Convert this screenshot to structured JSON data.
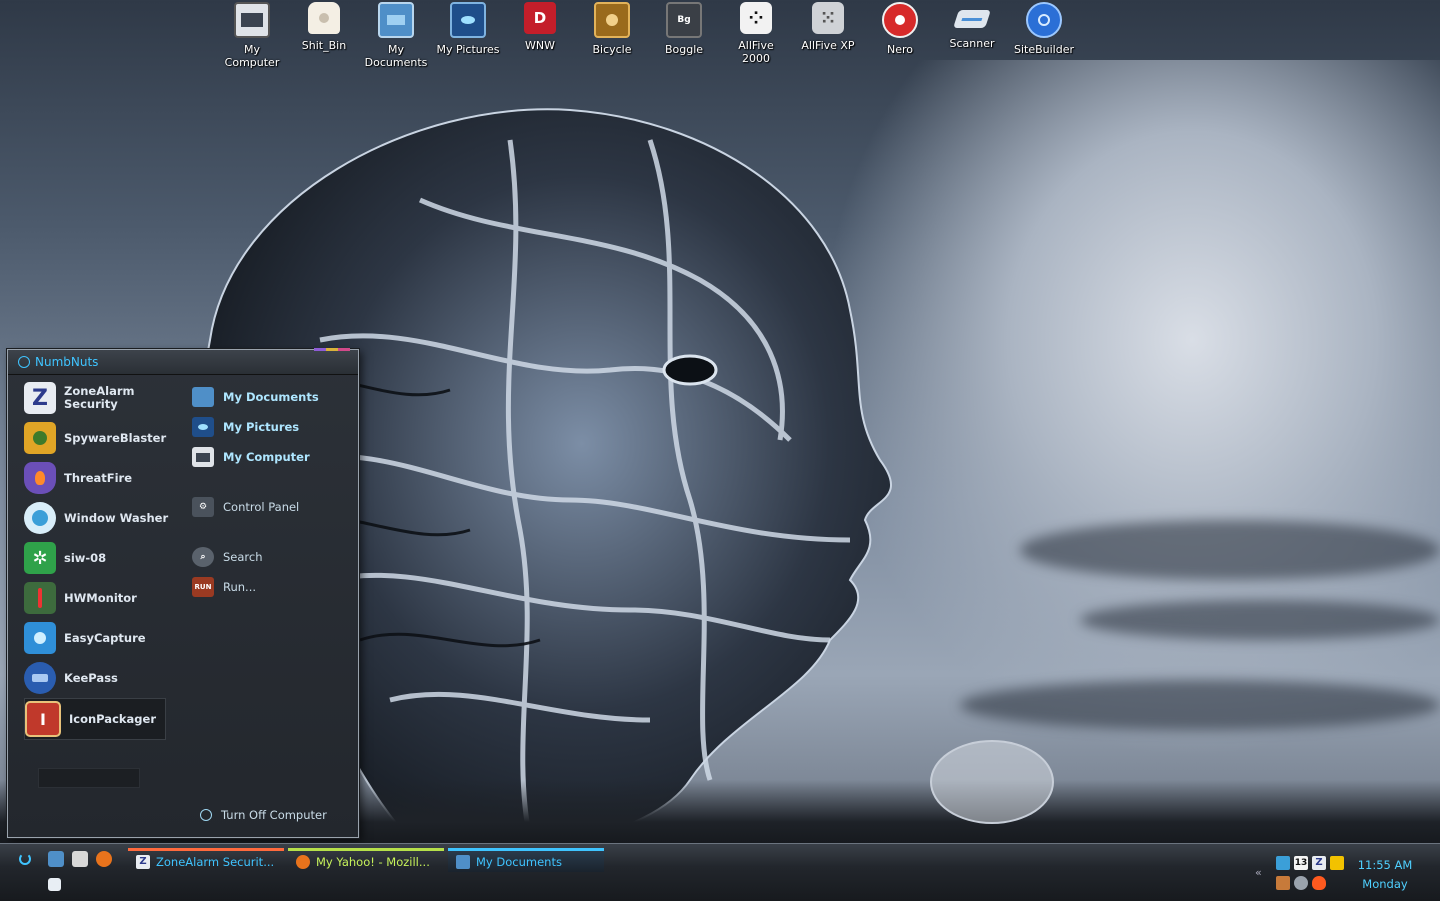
{
  "desktop_icons": [
    {
      "label": "My\nComputer",
      "icon": "monitor-icon"
    },
    {
      "label": "Shit_Bin",
      "icon": "recycle-bin-icon"
    },
    {
      "label": "My\nDocuments",
      "icon": "documents-icon"
    },
    {
      "label": "My Pictures",
      "icon": "pictures-icon"
    },
    {
      "label": "WNW",
      "icon": "wnw-icon"
    },
    {
      "label": "Bicycle",
      "icon": "bicycle-cards-icon"
    },
    {
      "label": "Boggle",
      "icon": "boggle-icon"
    },
    {
      "label": "AllFive\n2000",
      "icon": "dice-icon"
    },
    {
      "label": "AllFive XP",
      "icon": "dice-xp-icon"
    },
    {
      "label": "Nero",
      "icon": "nero-icon"
    },
    {
      "label": "Scanner",
      "icon": "scanner-icon"
    },
    {
      "label": "SiteBuilder",
      "icon": "sitebuilder-icon"
    }
  ],
  "start_menu": {
    "user": "NumbNuts",
    "programs": [
      {
        "label": "ZoneAlarm\nSecurity",
        "icon": "zonealarm-icon",
        "glyph": "Z",
        "color": "#2d3b8c"
      },
      {
        "label": "SpywareBlaster",
        "icon": "spywareblaster-icon",
        "glyph": "",
        "color": "#e0a526"
      },
      {
        "label": "ThreatFire",
        "icon": "threatfire-icon",
        "glyph": "",
        "color": "#6b4fb8"
      },
      {
        "label": "Window Washer",
        "icon": "window-washer-icon",
        "glyph": "",
        "color": "#3b9fd8"
      },
      {
        "label": "siw-08",
        "icon": "siw-icon",
        "glyph": "",
        "color": "#2fa24a"
      },
      {
        "label": "HWMonitor",
        "icon": "hwmonitor-icon",
        "glyph": "",
        "color": "#3d6b3d"
      },
      {
        "label": "EasyCapture",
        "icon": "easycapture-icon",
        "glyph": "",
        "color": "#2f8fd8"
      },
      {
        "label": "KeePass",
        "icon": "keepass-icon",
        "glyph": "",
        "color": "#2a5db0"
      },
      {
        "label": "IconPackager",
        "icon": "iconpackager-icon",
        "glyph": "I",
        "color": "#c0392b"
      }
    ],
    "places": [
      {
        "label": "My Documents",
        "icon": "documents-icon",
        "bold": true
      },
      {
        "label": "My Pictures",
        "icon": "pictures-icon",
        "bold": true
      },
      {
        "label": "My Computer",
        "icon": "monitor-icon",
        "bold": true
      },
      {
        "label": "Control Panel",
        "icon": "control-panel-icon",
        "bold": false
      },
      {
        "label": "Search",
        "icon": "search-icon",
        "bold": false
      },
      {
        "label": "Run...",
        "icon": "run-icon",
        "bold": false
      }
    ],
    "turn_off": "Turn Off Computer"
  },
  "taskbar": {
    "tasks": [
      {
        "label": "ZoneAlarm Securit...",
        "icon": "zonealarm-icon",
        "accent": "#ff6a3d"
      },
      {
        "label": "My Yahoo! - Mozill...",
        "icon": "firefox-icon",
        "accent": "#b6e04a"
      },
      {
        "label": "My Documents",
        "icon": "documents-icon",
        "accent": "#3fc4ff"
      }
    ],
    "tray_badge": "13",
    "clock_time": "11:55 AM",
    "clock_day": "Monday"
  },
  "colors": {
    "accent": "#3fc4ff",
    "task_text_zonealarm": "#3fc4ff",
    "task_text_yahoo": "#c6f25a"
  }
}
